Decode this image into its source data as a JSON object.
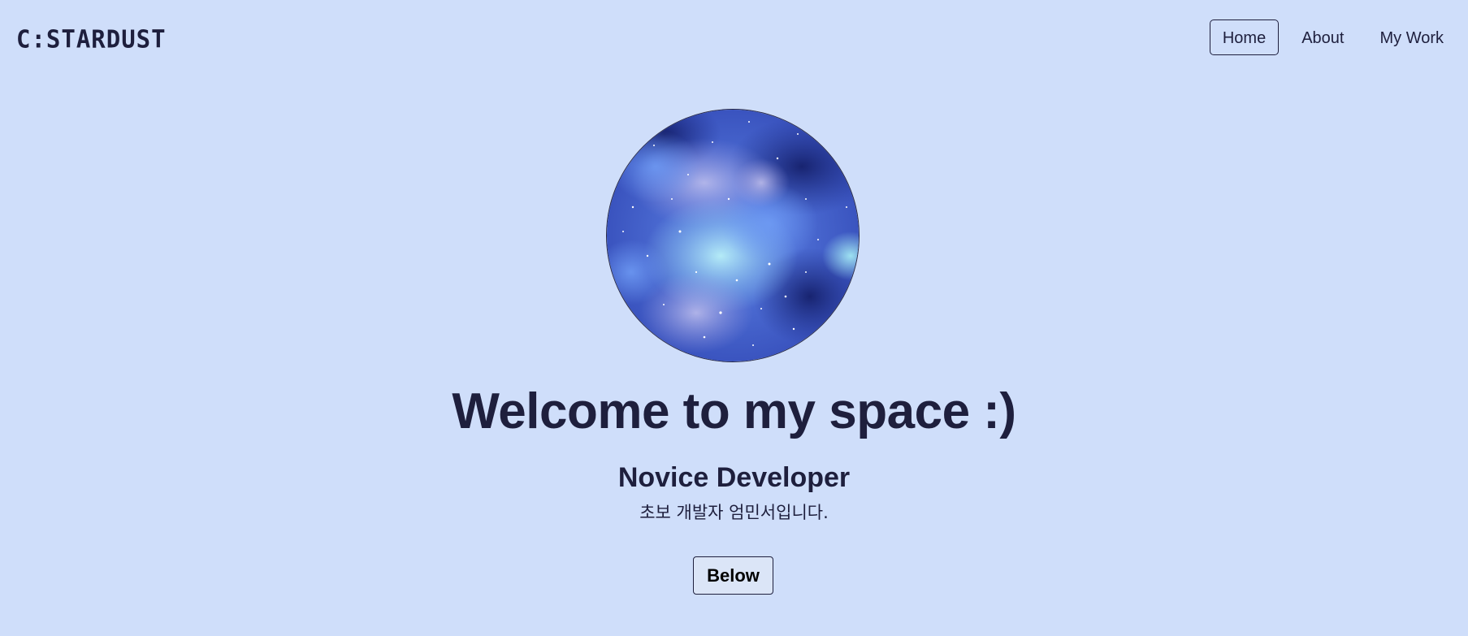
{
  "brand": {
    "logo_text": "C:STARDUST"
  },
  "nav": {
    "items": [
      {
        "label": "Home",
        "active": true
      },
      {
        "label": "About",
        "active": false
      },
      {
        "label": "My Work",
        "active": false
      }
    ]
  },
  "hero": {
    "avatar_icon": "galaxy-nebula-image",
    "title": "Welcome to my space :)",
    "subtitle": "Novice Developer",
    "description": "초보 개발자 엄민서입니다.",
    "button_label": "Below"
  },
  "colors": {
    "background": "#cfdefa",
    "text": "#1e1f3d",
    "accent_nebula_deep": "#1f2f8f",
    "accent_nebula_light": "#a9e6f4"
  }
}
